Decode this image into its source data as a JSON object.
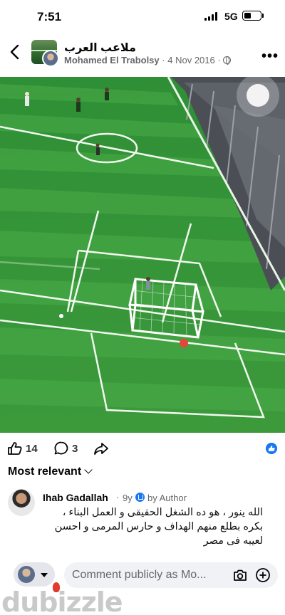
{
  "status_bar": {
    "time": "7:51",
    "network": "5G"
  },
  "post": {
    "group_name": "ملاعب العرب",
    "author": "Mohamed El Trabolsy",
    "separator": "·",
    "date": "4 Nov 2016",
    "audience_icon": "globe-icon",
    "photo_description_icon": "football-pitch-photo"
  },
  "reactions": {
    "likes": "14",
    "comments": "3",
    "like_icon": "thumbs-up-icon",
    "comment_icon": "speech-bubble-icon",
    "share_icon": "share-arrow-icon"
  },
  "sort": {
    "label": "Most relevant"
  },
  "comment": {
    "name": "Ihab Gadallah",
    "dot": "·",
    "age": "9y",
    "author_label": "by Author",
    "text": "الله ينور ، هو ده الشغل الحقيقى و العمل البناء ، بكره بطلع منهم الهداف و حارس المرمى و احسن لعيبه فى مصر"
  },
  "composer": {
    "placeholder": "Comment publicly as Mo..."
  },
  "watermark": {
    "text": "dubizzle"
  },
  "colors": {
    "accent": "#1877f2",
    "muted_text": "#65676b",
    "pitch_green": "#3f9a3d"
  }
}
